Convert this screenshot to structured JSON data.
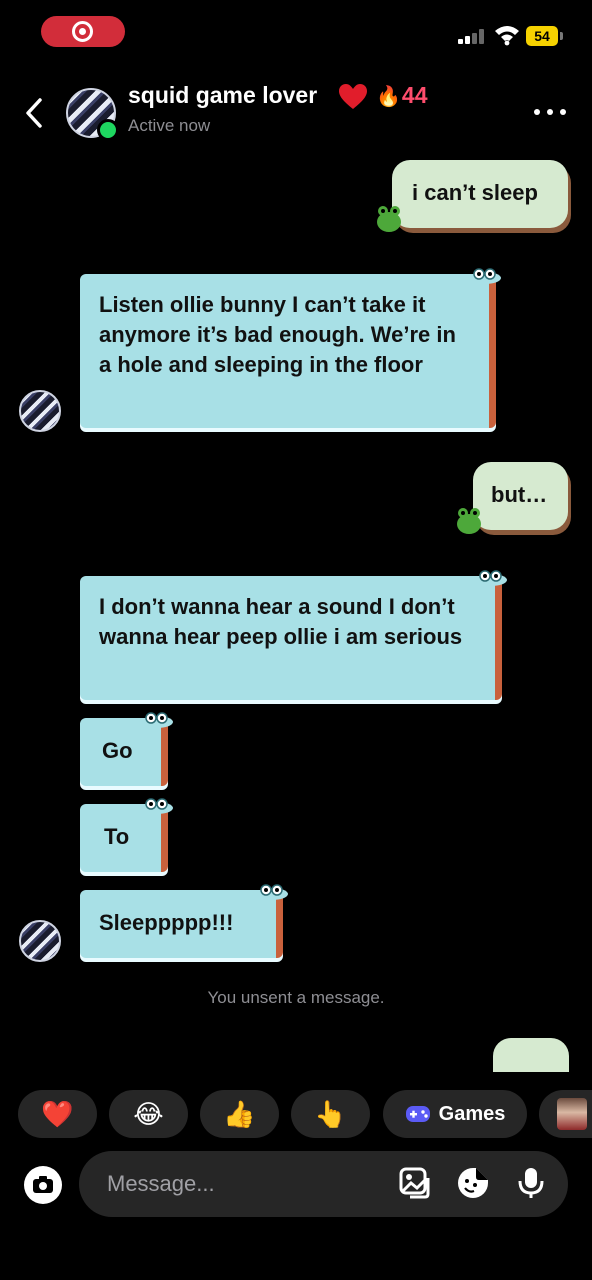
{
  "status_bar": {
    "battery": "54"
  },
  "header": {
    "name": "squid game lover",
    "name_heart": "heart-emoji",
    "streak_icon": "🔥",
    "streak_count": "44",
    "status": "Active now"
  },
  "messages": [
    {
      "dir": "out",
      "text": "i can’t sleep"
    },
    {
      "dir": "in",
      "text": "Listen ollie bunny I can’t take it anymore it’s bad enough. We’re in a hole and sleeping in the floor"
    },
    {
      "dir": "out",
      "text": "but…"
    },
    {
      "dir": "in",
      "text": "I don’t wanna hear a sound I don’t wanna hear peep ollie i am serious"
    },
    {
      "dir": "in",
      "text": "Go"
    },
    {
      "dir": "in",
      "text": "To"
    },
    {
      "dir": "in",
      "text": "Sleeppppp!!!"
    }
  ],
  "system_note": "You unsent a message.",
  "quick_reactions": [
    {
      "icon": "heart-emoji",
      "glyph": "❤️"
    },
    {
      "icon": "laughing-emoji",
      "glyph": "😂"
    },
    {
      "icon": "thumbs-up-emoji",
      "glyph": "👍"
    },
    {
      "icon": "pointing-hand-emoji",
      "glyph": "👆"
    }
  ],
  "games_label": "Games",
  "composer": {
    "placeholder": "Message..."
  },
  "colors": {
    "background": "#000000",
    "outgoing_bubble": "#d6ead0",
    "incoming_bubble": "#a8e0e6",
    "accent_red": "#ff4d6d",
    "online": "#1ed760",
    "battery": "#f6d200"
  }
}
